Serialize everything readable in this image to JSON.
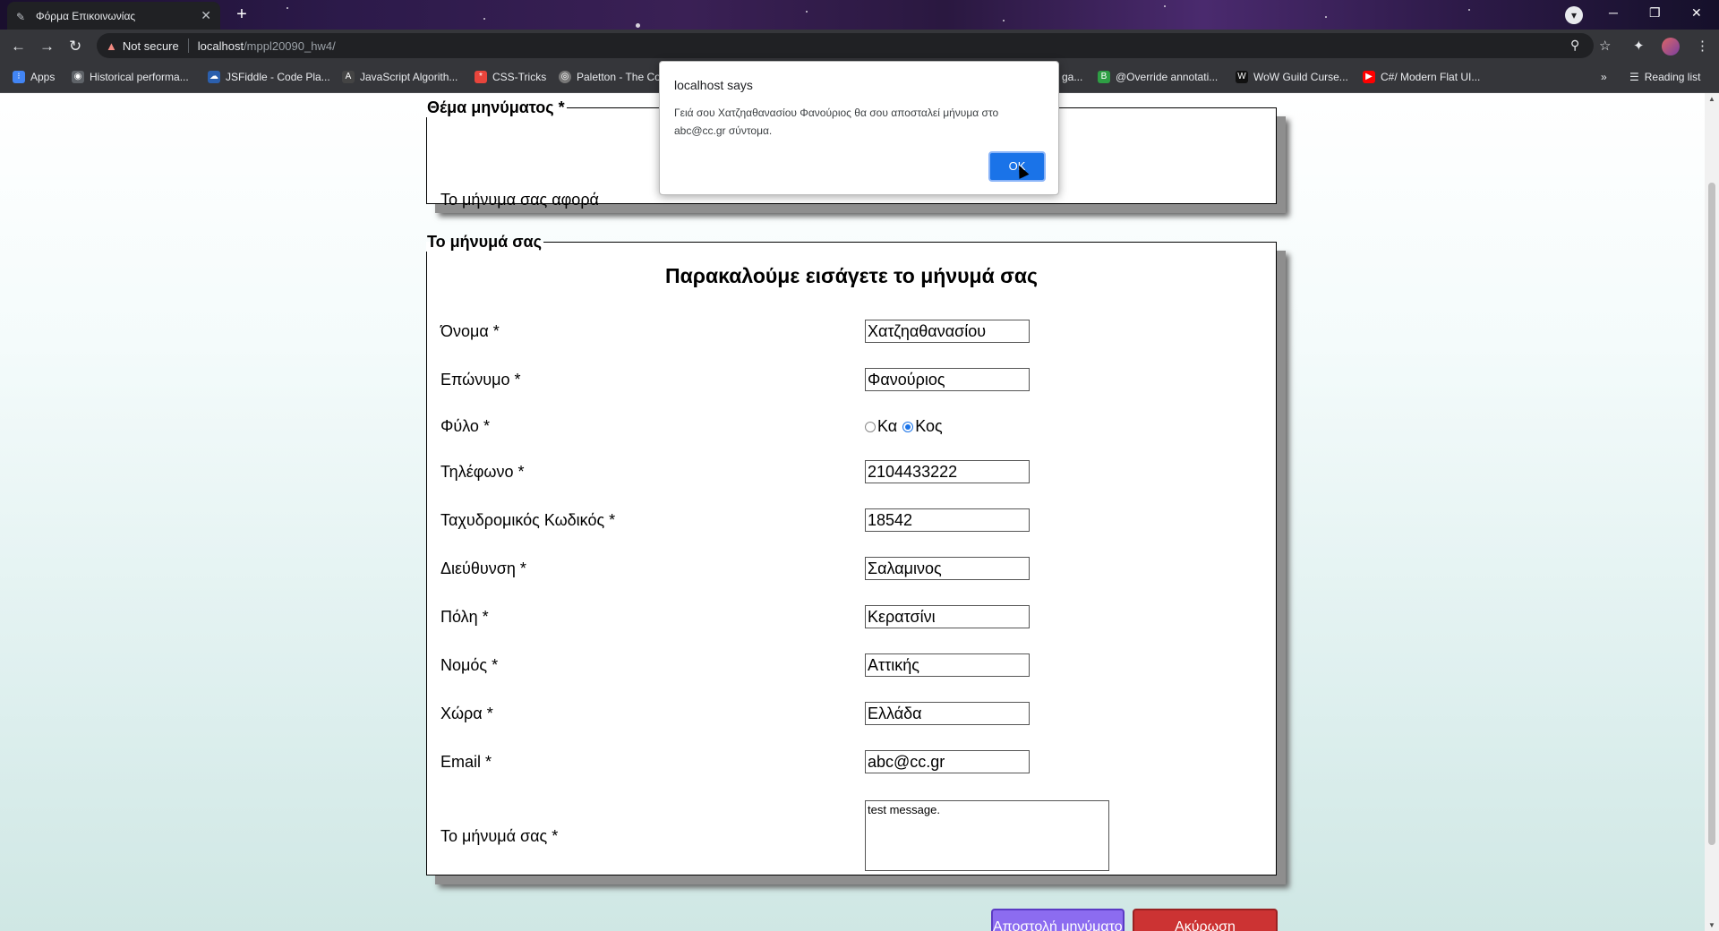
{
  "browser": {
    "tab_title": "Φόρμα Επικοινωνίας",
    "url_warning": "Not secure",
    "url_host": "localhost",
    "url_path": "/mppl20090_hw4/",
    "bookmarks": [
      {
        "label": "Apps",
        "icon": "apps-grid-icon"
      },
      {
        "label": "Historical performa...",
        "icon": "globe-icon"
      },
      {
        "label": "JSFiddle - Code Pla...",
        "icon": "jsfiddle-icon"
      },
      {
        "label": "JavaScript Algorith...",
        "icon": "js-icon"
      },
      {
        "label": "CSS-Tricks",
        "icon": "css-tricks-icon"
      },
      {
        "label": "Paletton - The Co",
        "icon": "paletton-icon"
      },
      {
        "label": "ga...",
        "icon": "bookmark-icon"
      },
      {
        "label": "@Override annotati...",
        "icon": "b-icon"
      },
      {
        "label": "WoW Guild Curse...",
        "icon": "w-icon"
      },
      {
        "label": "C#/ Modern Flat UI...",
        "icon": "youtube-icon"
      }
    ],
    "reading_list": "Reading list"
  },
  "form": {
    "subject_legend": "Θέμα μηνύματος *",
    "subject_label": "Το μήνυμα σας αφορά",
    "message_legend": "Το μήνυμά σας",
    "heading": "Παρακαλούμε εισάγετε το μήνυμά σας",
    "fields": [
      {
        "label": "Όνομα *",
        "value": "Χατζηαθανασίου"
      },
      {
        "label": "Επώνυμο *",
        "value": "Φανούριος"
      },
      {
        "label": "Τηλέφωνο *",
        "value": "2104433222"
      },
      {
        "label": "Ταχυδρομικός Κωδικός *",
        "value": "18542"
      },
      {
        "label": "Διεύθυνση *",
        "value": "Σαλαμινος"
      },
      {
        "label": "Πόλη *",
        "value": "Κερατσίνι"
      },
      {
        "label": "Νομός *",
        "value": "Αττικής"
      },
      {
        "label": "Χώρα *",
        "value": "Ελλάδα"
      },
      {
        "label": "Email *",
        "value": "abc@cc.gr"
      }
    ],
    "gender_label": "Φύλο *",
    "gender_options": [
      "Κα",
      "Κος"
    ],
    "gender_selected": "Κος",
    "message_label": "Το μήνυμά σας *",
    "message_value": "test message.",
    "send_button": "Αποστολή μηνύματος",
    "cancel_button": "Ακύρωση"
  },
  "dialog": {
    "title": "localhost says",
    "text": "Γειά σου Χατζηαθανασίου Φανούριος θα σου αποσταλεί μήνυμα στο abc@cc.gr σύντομα.",
    "ok": "OK"
  }
}
